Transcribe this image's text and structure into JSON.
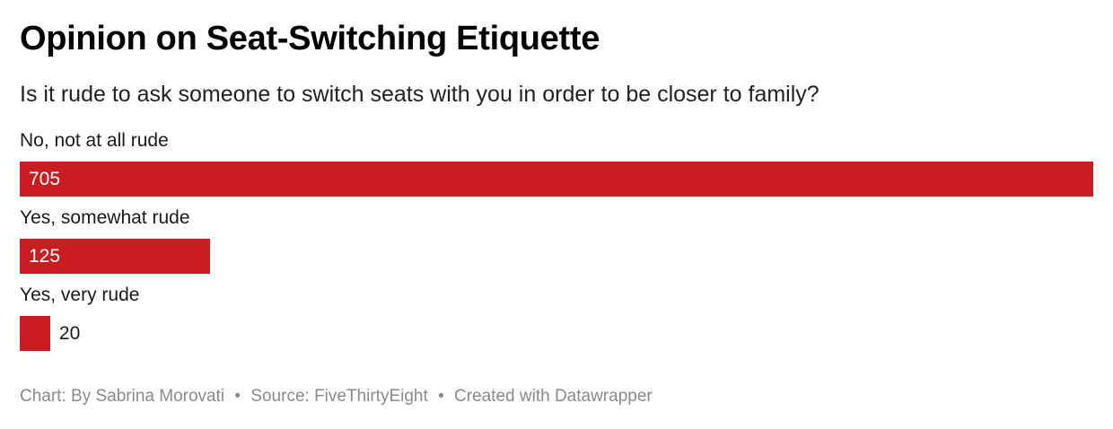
{
  "title": "Opinion on Seat-Switching Etiquette",
  "subtitle": "Is it rude to ask someone to switch seats with you in order to be closer to family?",
  "chart_data": {
    "type": "bar",
    "orientation": "horizontal",
    "categories": [
      "No, not at all rude",
      "Yes, somewhat rude",
      "Yes, very rude"
    ],
    "values": [
      705,
      125,
      20
    ],
    "bar_color": "#c91d21",
    "title": "Opinion on Seat-Switching Etiquette",
    "subtitle": "Is it rude to ask someone to switch seats with you in order to be closer to family?",
    "xlim": [
      0,
      705
    ],
    "grid": false,
    "legend": "none"
  },
  "footer": {
    "credit": "Chart: By Sabrina Morovati",
    "source": "Source: FiveThirtyEight",
    "tool": "Created with Datawrapper",
    "separator": "•"
  }
}
